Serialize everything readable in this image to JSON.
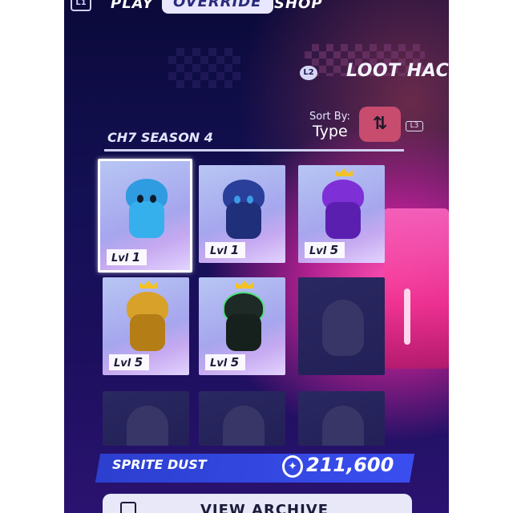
{
  "topbar": {
    "l1": "L1",
    "play": "PLAY",
    "override": "OVERRIDE",
    "shop": "SHOP"
  },
  "header": {
    "l2": "L2",
    "title": "LOOT HACK"
  },
  "sort": {
    "label": "Sort By:",
    "value": "Type",
    "icon": "sort-arrows-icon",
    "l3": "L3"
  },
  "section": {
    "title": "CH7 SEASON 4"
  },
  "tiles": [
    {
      "level_prefix": "Lvl",
      "level": "1",
      "color": "#2fa8ea",
      "selected": true
    },
    {
      "level_prefix": "Lvl",
      "level": "1",
      "color": "#2b3a8a",
      "selected": false
    },
    {
      "level_prefix": "Lvl",
      "level": "5",
      "color": "#8a2bd8",
      "selected": false
    },
    {
      "level_prefix": "Lvl",
      "level": "5",
      "color": "#d6a22b",
      "selected": false
    },
    {
      "level_prefix": "Lvl",
      "level": "5",
      "color": "#1f2a28",
      "selected": false
    },
    {
      "locked": true
    },
    {
      "locked": true
    },
    {
      "locked": true
    },
    {
      "locked": true
    }
  ],
  "currency": {
    "label": "SPRITE DUST",
    "icon": "sprite-dust-icon",
    "value": "211,600"
  },
  "archive": {
    "label": "VIEW ARCHIVE",
    "icon": "archive-icon"
  }
}
